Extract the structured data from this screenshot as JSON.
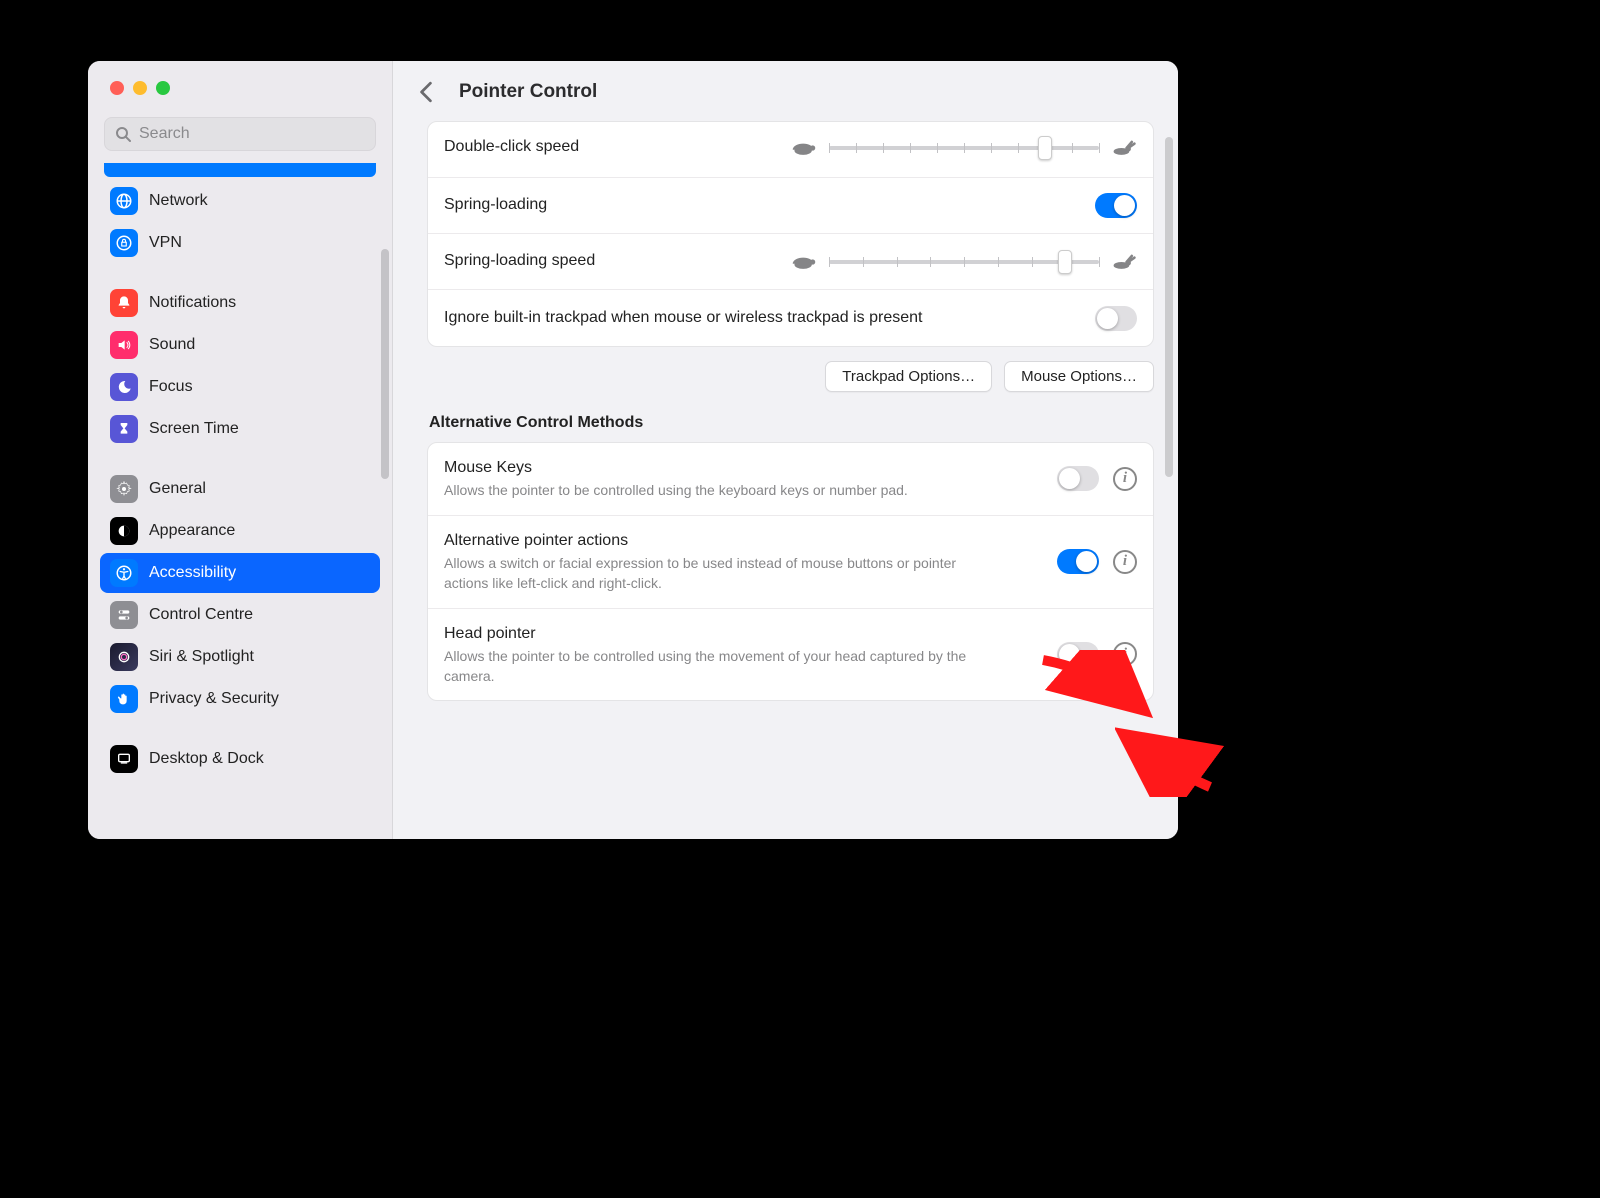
{
  "header": {
    "title": "Pointer Control"
  },
  "search": {
    "placeholder": "Search"
  },
  "sidebar": {
    "items": [
      {
        "label": "Network"
      },
      {
        "label": "VPN"
      },
      {
        "label": "Notifications"
      },
      {
        "label": "Sound"
      },
      {
        "label": "Focus"
      },
      {
        "label": "Screen Time"
      },
      {
        "label": "General"
      },
      {
        "label": "Appearance"
      },
      {
        "label": "Accessibility"
      },
      {
        "label": "Control Centre"
      },
      {
        "label": "Siri & Spotlight"
      },
      {
        "label": "Privacy & Security"
      },
      {
        "label": "Desktop & Dock"
      }
    ]
  },
  "group1": {
    "double_click_speed": "Double-click speed",
    "spring_loading": "Spring-loading",
    "spring_loading_speed": "Spring-loading speed",
    "ignore_trackpad": "Ignore built-in trackpad when mouse or wireless trackpad is present"
  },
  "buttons": {
    "trackpad_options": "Trackpad Options…",
    "mouse_options": "Mouse Options…"
  },
  "section_header": "Alternative Control Methods",
  "alt_methods": {
    "mouse_keys_title": "Mouse Keys",
    "mouse_keys_desc": "Allows the pointer to be controlled using the keyboard keys or number pad.",
    "apa_title": "Alternative pointer actions",
    "apa_desc": "Allows a switch or facial expression to be used instead of mouse buttons or pointer actions like left-click and right-click.",
    "head_title": "Head pointer",
    "head_desc": "Allows the pointer to be controlled using the movement of your head captured by the camera."
  },
  "toggles": {
    "spring_loading": true,
    "ignore_trackpad": false,
    "mouse_keys": false,
    "apa": true,
    "head": false
  },
  "sliders": {
    "double_click_percent": 80,
    "spring_loading_percent": 87
  },
  "colors": {
    "blue": "#007AFF",
    "sidebar_selected": "#0a66ff"
  }
}
